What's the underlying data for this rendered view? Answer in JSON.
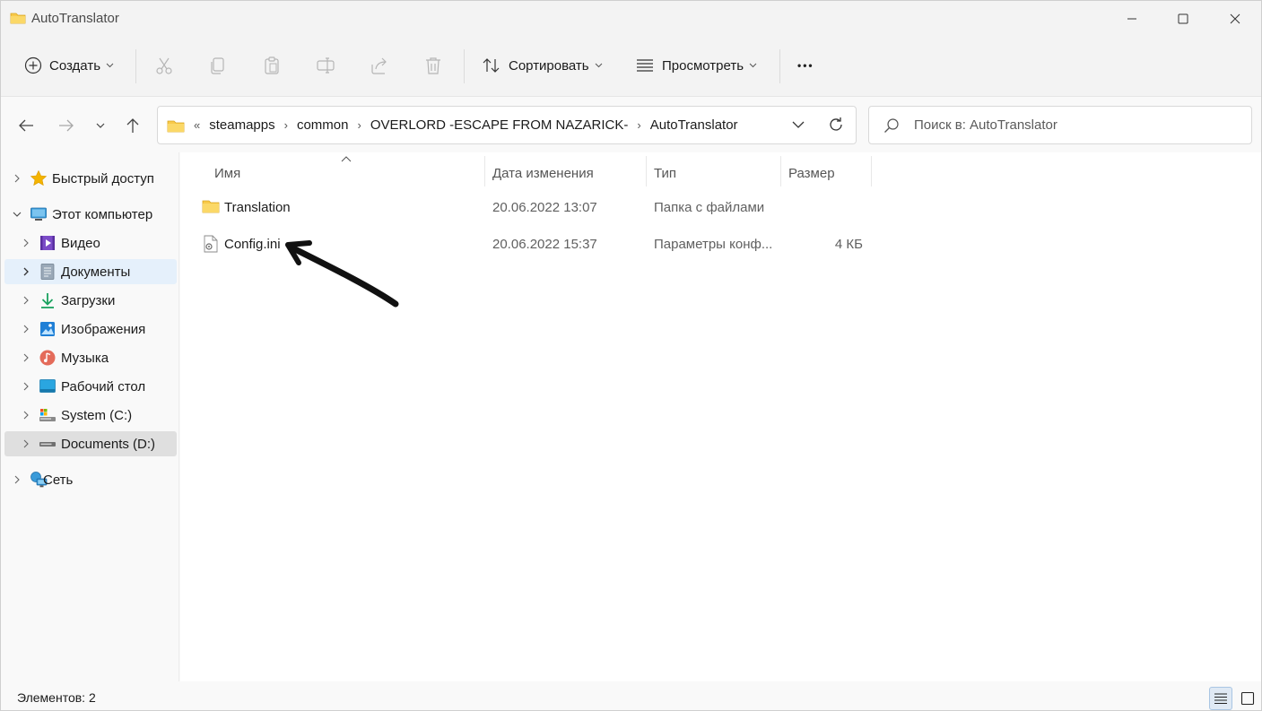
{
  "window": {
    "title": "AutoTranslator"
  },
  "command_bar": {
    "create_label": "Создать",
    "sort_label": "Сортировать",
    "view_label": "Просмотреть",
    "more_label": "•••"
  },
  "address": {
    "overflow": "«",
    "crumbs": [
      "steamapps",
      "common",
      "OVERLORD -ESCAPE FROM NAZARICK-",
      "AutoTranslator"
    ],
    "separator": "›"
  },
  "search": {
    "placeholder": "Поиск в: AutoTranslator"
  },
  "sidebar": {
    "items": [
      {
        "label": "Быстрый доступ",
        "icon": "star-icon"
      },
      {
        "label": "Этот компьютер",
        "icon": "computer-icon"
      },
      {
        "label": "Видео",
        "icon": "video-icon"
      },
      {
        "label": "Документы",
        "icon": "documents-icon"
      },
      {
        "label": "Загрузки",
        "icon": "downloads-icon"
      },
      {
        "label": "Изображения",
        "icon": "pictures-icon"
      },
      {
        "label": "Музыка",
        "icon": "music-icon"
      },
      {
        "label": "Рабочий стол",
        "icon": "desktop-icon"
      },
      {
        "label": "System (C:)",
        "icon": "drive-c-icon"
      },
      {
        "label": "Documents (D:)",
        "icon": "drive-d-icon"
      },
      {
        "label": "Сеть",
        "icon": "network-icon"
      }
    ]
  },
  "file_list": {
    "columns": {
      "name": "Имя",
      "date": "Дата изменения",
      "type": "Тип",
      "size": "Размер"
    },
    "rows": [
      {
        "name": "Translation",
        "date": "20.06.2022 13:07",
        "type": "Папка с файлами",
        "size": ""
      },
      {
        "name": "Config.ini",
        "date": "20.06.2022 15:37",
        "type": "Параметры конф...",
        "size": "4 КБ"
      }
    ]
  },
  "status": {
    "items_count": "Элементов: 2"
  },
  "colors": {
    "accent": "#0067c0",
    "folder_yellow": "#f8c94a",
    "selection_blue": "#e5f0fb"
  }
}
